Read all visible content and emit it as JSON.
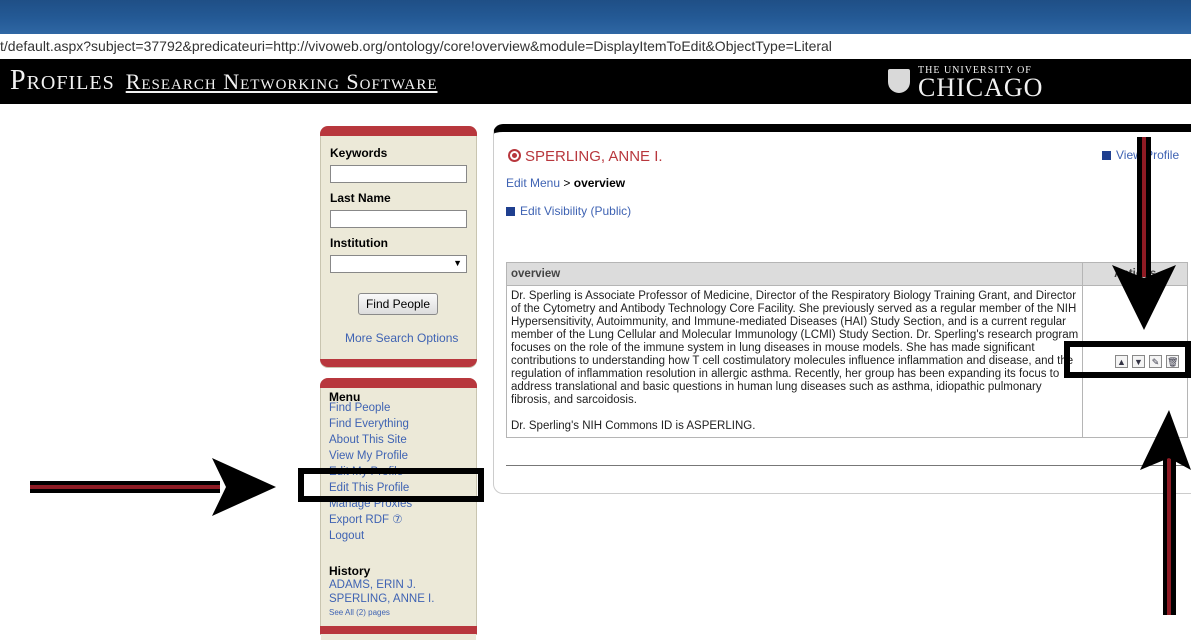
{
  "browser": {
    "url": "t/default.aspx?subject=37792&predicateuri=http://vivoweb.org/ontology/core!overview&module=DisplayItemToEdit&ObjectType=Literal"
  },
  "header": {
    "brand_main": "Profiles",
    "brand_sub": "Research Networking Software",
    "university_small": "THE UNIVERSITY OF",
    "university_big": "CHICAGO"
  },
  "search": {
    "keywords_label": "Keywords",
    "keywords_value": "",
    "lastname_label": "Last Name",
    "lastname_value": "",
    "institution_label": "Institution",
    "institution_value": "",
    "find_button": "Find People",
    "more_options": "More Search Options"
  },
  "menu": {
    "title": "Menu",
    "items": [
      {
        "label": "Find People"
      },
      {
        "label": "Find Everything"
      },
      {
        "label": "About This Site"
      },
      {
        "label": "View My Profile"
      },
      {
        "label": "Edit My Profile"
      },
      {
        "label": "Edit This Profile"
      },
      {
        "label": "Manage Proxies"
      },
      {
        "label": "Export RDF ⑦"
      },
      {
        "label": "Logout"
      }
    ],
    "history_title": "History",
    "history_items": [
      {
        "label": "ADAMS, ERIN J."
      },
      {
        "label": "SPERLING, ANNE I."
      }
    ],
    "see_all": "See All (2) pages"
  },
  "profile": {
    "name": "SPERLING, ANNE I.",
    "view_profile": "View Profile",
    "breadcrumb_link": "Edit Menu",
    "breadcrumb_sep": ">",
    "breadcrumb_current": "overview",
    "visibility": "Edit Visibility (Public)",
    "table_header": "overview",
    "actions_header": "Actions",
    "overview_p1": "Dr. Sperling is Associate Professor of Medicine, Director of the Respiratory Biology Training Grant, and Director of the Cytometry and Antibody Technology Core Facility. She previously served as a regular member of the NIH Hypersensitivity, Autoimmunity, and Immune-mediated Diseases (HAI) Study Section, and is a current regular member of the Lung Cellular and Molecular Immunology (LCMI) Study Section. Dr. Sperling's research program focuses on the role of the immune system in lung diseases in mouse models. She has made significant contributions to understanding how T cell costimulatory molecules influence inflammation and disease, and the regulation of inflammation resolution in allergic asthma. Recently, her group has been expanding its focus to address translational and basic questions in human lung diseases such as asthma, idiopathic pulmonary fibrosis, and sarcoidosis.",
    "overview_p2": "Dr. Sperling's NIH Commons ID is ASPERLING."
  },
  "colors": {
    "accent_red": "#b8373d",
    "link_blue": "#3f63b3",
    "annotation_black": "#000000"
  }
}
